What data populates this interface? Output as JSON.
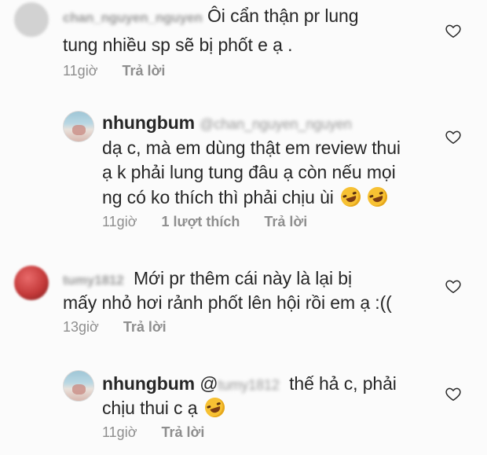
{
  "comments": [
    {
      "username": "chan_nguyen_nguyen",
      "lines": [
        "Ôi cẩn thận pr lung",
        "tung nhiều sp sẽ bị phốt e ạ ."
      ],
      "time": "11giờ",
      "reply": "Trả lời"
    },
    {
      "username": "nhungbum",
      "mention": "@chan_nguyen_nguyen",
      "lines": [
        "dạ c, mà em dùng thật em review thui",
        "ạ k phải lung tung đâu ạ còn nếu mọi",
        "ng có ko thích thì phải chịu ùi"
      ],
      "time": "11giờ",
      "likes": "1 lượt thích",
      "reply": "Trả lời"
    },
    {
      "username": "tumy1812",
      "lines": [
        "Mới pr thêm cái này là lại bị",
        "mấy nhỏ hơi rảnh phốt lên hội rồi em ạ :(("
      ],
      "time": "13giờ",
      "reply": "Trả lời"
    },
    {
      "username": "nhungbum",
      "mention_prefix": "@",
      "mention": "tumy1812",
      "lines": [
        "thế hả c, phải",
        "chịu thui c ạ"
      ],
      "time": "11giờ",
      "reply": "Trả lời"
    }
  ],
  "icons": {
    "like": "heart-outline-icon",
    "emoji": "rolling-on-floor-laughing-emoji"
  }
}
